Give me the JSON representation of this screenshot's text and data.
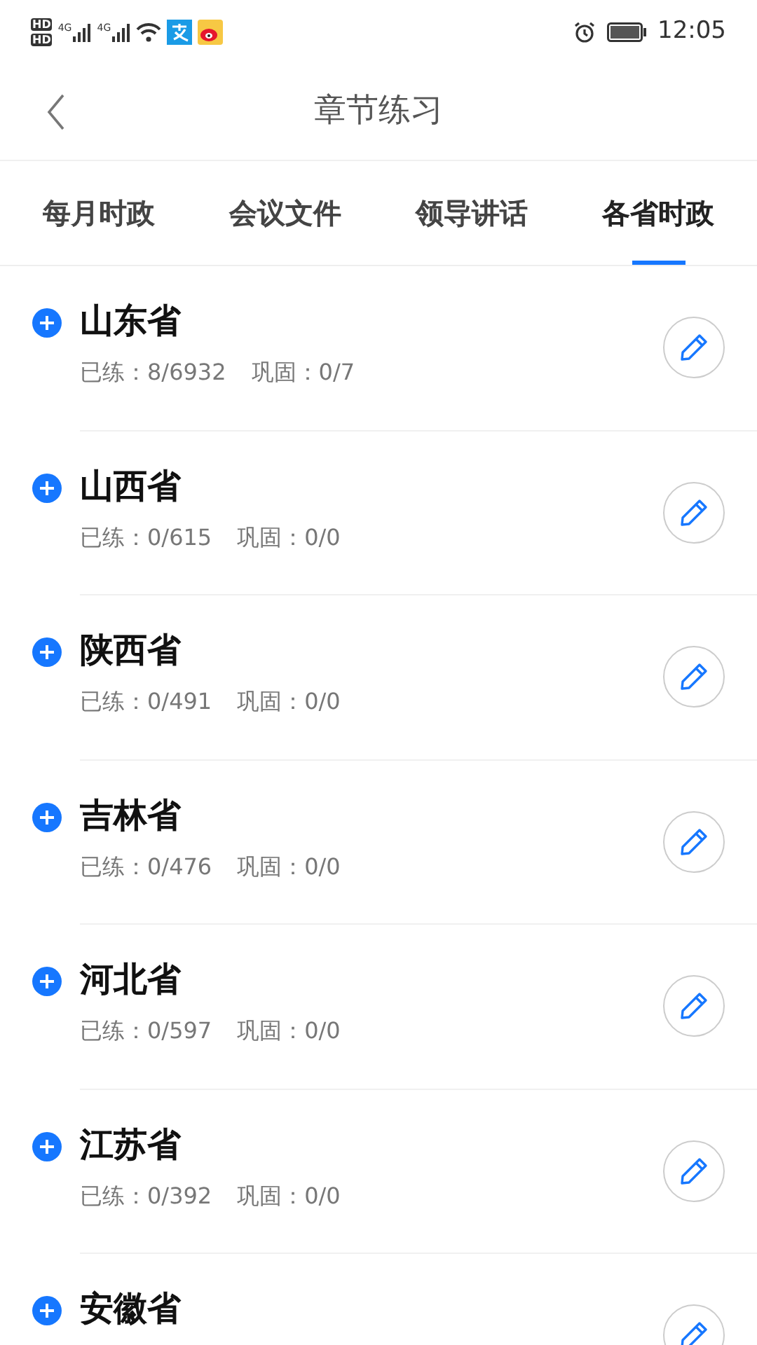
{
  "status_bar": {
    "sim_labels": [
      "HD",
      "HD"
    ],
    "network_labels": [
      "4G",
      "4G"
    ],
    "time": "12:05"
  },
  "header": {
    "title": "章节练习"
  },
  "tabs": [
    {
      "label": "每月时政",
      "selected": false
    },
    {
      "label": "会议文件",
      "selected": false
    },
    {
      "label": "领导讲话",
      "selected": false
    },
    {
      "label": "各省时政",
      "selected": true
    }
  ],
  "chapters": [
    {
      "name": "山东省",
      "practiced": "已练：8/6932",
      "reviewed": "巩固：0/7"
    },
    {
      "name": "山西省",
      "practiced": "已练：0/615",
      "reviewed": "巩固：0/0"
    },
    {
      "name": "陕西省",
      "practiced": "已练：0/491",
      "reviewed": "巩固：0/0"
    },
    {
      "name": "吉林省",
      "practiced": "已练：0/476",
      "reviewed": "巩固：0/0"
    },
    {
      "name": "河北省",
      "practiced": "已练：0/597",
      "reviewed": "巩固：0/0"
    },
    {
      "name": "江苏省",
      "practiced": "已练：0/392",
      "reviewed": "巩固：0/0"
    },
    {
      "name": "安徽省"
    }
  ]
}
